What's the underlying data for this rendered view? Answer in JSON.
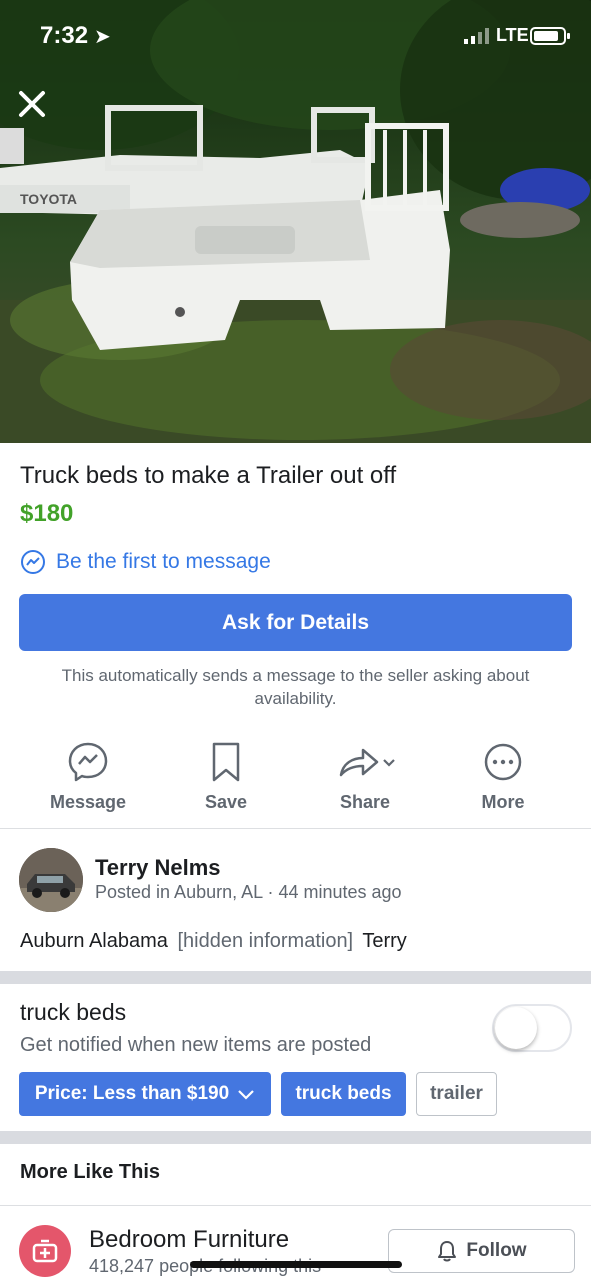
{
  "status_bar": {
    "time": "7:32",
    "network": "LTE"
  },
  "listing": {
    "title": "Truck beds to make a Trailer out off",
    "price": "$180",
    "first_message": "Be the first to message",
    "ask_button": "Ask for Details",
    "auto_note": "This automatically sends a message to the seller asking about availability."
  },
  "actions": [
    {
      "label": "Message",
      "icon": "messenger-icon"
    },
    {
      "label": "Save",
      "icon": "bookmark-icon"
    },
    {
      "label": "Share",
      "icon": "share-icon"
    },
    {
      "label": "More",
      "icon": "more-icon"
    }
  ],
  "seller": {
    "name": "Terry Nelms",
    "meta": "Posted in Auburn, AL · 44 minutes ago"
  },
  "description": {
    "location": "Auburn Alabama",
    "hidden": "[hidden information]",
    "name": "Terry"
  },
  "alert": {
    "title": "truck beds",
    "subtitle": "Get notified when new items are posted",
    "toggle_on": false,
    "chips": [
      {
        "label": "Price: Less than $190",
        "style": "blue",
        "has_dropdown": true
      },
      {
        "label": "truck beds",
        "style": "blue"
      },
      {
        "label": "trailer",
        "style": "outline"
      }
    ]
  },
  "more_like_this": {
    "heading": "More Like This",
    "item": {
      "title": "Bedroom Furniture",
      "subtitle": "418,247 people following this",
      "follow_label": "Follow"
    }
  },
  "colors": {
    "accent": "#4477e0",
    "price": "#42a229",
    "link": "#3578e5",
    "category_icon": "#e4566b"
  }
}
